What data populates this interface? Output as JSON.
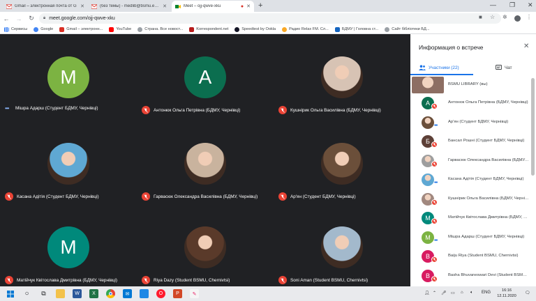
{
  "browser": {
    "tabs": [
      {
        "label": "Gmail – электронная почта от G",
        "active": false
      },
      {
        "label": "(без темы) - medlib@bsmu.edu.",
        "active": false
      },
      {
        "label": "Meet – ojj-qwve-xku",
        "active": true
      }
    ],
    "new_tab": "+",
    "url": "meet.google.com/ojj-qwve-xku",
    "bookmarks": [
      "Сервисы",
      "Google",
      "Gmail – электронн...",
      "YouTube",
      "Страна. Все новост...",
      "Korrespondent.net",
      "Speedtest by Ookla",
      "Радио Relax FM. Сл...",
      "БДМУ | Головна ст...",
      "Сайт бібліотеки БД..."
    ]
  },
  "grid": {
    "tiles": [
      {
        "name": "Мішра Адарш (Студент БДМУ, Чернівці)",
        "initial": "M",
        "color": "#7cb342",
        "photo": false,
        "muted": false
      },
      {
        "name": "Антонюк Ольга Петрівна (БДМУ, Чернівці)",
        "initial": "A",
        "color": "#0b6e4f",
        "photo": false,
        "muted": true
      },
      {
        "name": "Кушнірик Ольга Василівна (БДМУ, Чернівці)",
        "initial": "",
        "color": "#d7c3b4",
        "photo": true,
        "muted": true
      },
      {
        "name": "Касана Адітія (Студент БДМУ, Чернівці)",
        "initial": "",
        "color": "#5fa8d3",
        "photo": true,
        "muted": true
      },
      {
        "name": "Гарвасюк Олександра Василівна (БДМУ, Чернівці)",
        "initial": "",
        "color": "#c9b39e",
        "photo": true,
        "muted": true
      },
      {
        "name": "Ар'ян (Студент БДМУ, Чернівці)",
        "initial": "",
        "color": "#6b4f3a",
        "photo": true,
        "muted": true
      },
      {
        "name": "Матійчук Квітослава Дмитрівна (БДМУ, Чернівці)",
        "initial": "M",
        "color": "#00897b",
        "photo": false,
        "muted": true
      },
      {
        "name": "Riya Dazy (Student BSMU, Chernivtsi)",
        "initial": "",
        "color": "#5a3a2a",
        "photo": true,
        "muted": true
      },
      {
        "name": "Soni Aman (Student BSMU, Chernivtsi)",
        "initial": "",
        "color": "#a3b9cc",
        "photo": true,
        "muted": true
      }
    ]
  },
  "panel": {
    "title": "Информация о встрече",
    "tab_people": "Участники (22)",
    "tab_chat": "Чат",
    "participants": [
      {
        "name": "BSMU LIBRARY (вы)",
        "initial": "",
        "color": "#8d6e63",
        "muted": false,
        "speaking": false,
        "photo": true
      },
      {
        "name": "Антонюк Ольга Петрівна (БДМУ, Чернівці)",
        "initial": "А",
        "color": "#0b6e4f",
        "muted": true,
        "speaking": false,
        "photo": false
      },
      {
        "name": "Ар'ян (Студент БДМУ, Чернівці)",
        "initial": "",
        "color": "#6b4f3a",
        "muted": false,
        "speaking": true,
        "photo": true
      },
      {
        "name": "Бансал Рошні (Студент БДМУ, Чернівці)",
        "initial": "Б",
        "color": "#5d4037",
        "muted": true,
        "speaking": false,
        "photo": false
      },
      {
        "name": "Гарвасюк Олександра Василівна (БДМУ, Чернівці)",
        "initial": "",
        "color": "#9e9e9e",
        "muted": true,
        "speaking": false,
        "photo": true
      },
      {
        "name": "Касана Адітія (Студент БДМУ, Чернівці)",
        "initial": "",
        "color": "#5fa8d3",
        "muted": false,
        "speaking": true,
        "photo": true
      },
      {
        "name": "Кушнірик Ольга Василівна (БДМУ, Чернівці)",
        "initial": "",
        "color": "#a1887f",
        "muted": true,
        "speaking": false,
        "photo": true
      },
      {
        "name": "Матійчук Квітослава Дмитрівна (БДМУ, Чернівці)",
        "initial": "M",
        "color": "#00897b",
        "muted": true,
        "speaking": false,
        "photo": false
      },
      {
        "name": "Мішра Адарш (Студент БДМУ, Чернівці)",
        "initial": "M",
        "color": "#7cb342",
        "muted": false,
        "speaking": true,
        "photo": false
      },
      {
        "name": "Baiju Riya (Student BSMU, Chernivtsi)",
        "initial": "B",
        "color": "#d81b60",
        "muted": true,
        "speaking": false,
        "photo": false
      },
      {
        "name": "Basha Bhuvaneswari Devi (Student BSMU, Chernivtsi)",
        "initial": "B",
        "color": "#d81b60",
        "muted": true,
        "speaking": false,
        "photo": false
      }
    ]
  },
  "taskbar": {
    "lang": "ENG",
    "time": "16:16",
    "date": "12.11.2020"
  }
}
